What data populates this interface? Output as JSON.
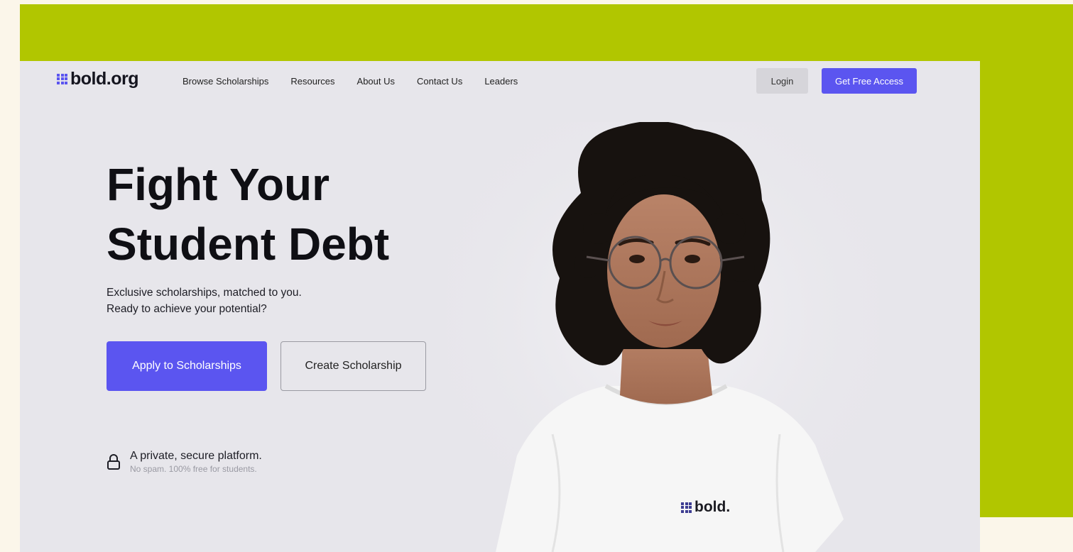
{
  "nav": {
    "logo_text": "bold.org",
    "links": [
      "Browse Scholarships",
      "Resources",
      "About Us",
      "Contact Us",
      "Leaders"
    ],
    "login_label": "Login",
    "access_label": "Get Free Access"
  },
  "hero": {
    "title_line1": "Fight Your",
    "title_line2": "Student Debt",
    "subtitle_line1": "Exclusive scholarships, matched to you.",
    "subtitle_line2": "Ready to achieve your potential?",
    "apply_label": "Apply to Scholarships",
    "create_label": "Create Scholarship"
  },
  "secure": {
    "icon": "lock-icon",
    "title": "A private, secure platform.",
    "subtitle": "No spam. 100% free for students."
  },
  "shirt_logo_text": "bold.",
  "colors": {
    "accent": "#5b55f0",
    "green_panel": "#b1c600",
    "page_bg": "#fbf6ea",
    "site_bg": "#e7e6eb"
  }
}
